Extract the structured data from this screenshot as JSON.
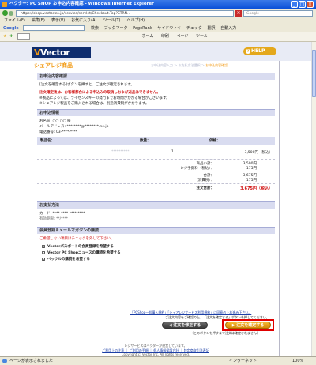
{
  "window": {
    "title": "ベクター: PC SHOP お申込内容確認 - Windows Internet Explorer",
    "minimize": "_",
    "maximize": "□",
    "close": "×"
  },
  "address": {
    "url": "https://shop.vector.co.jp/service/servlet/Checkout.Top?STRN…",
    "search_placeholder": "Google"
  },
  "menu": [
    "ファイル(F)",
    "編集(E)",
    "表示(V)",
    "お気に入り(A)",
    "ツール(T)",
    "ヘルプ(H)"
  ],
  "gbar": {
    "brand": "Google",
    "items": [
      "検索",
      "ブックマーク",
      "PageRank",
      "サイドウィキ",
      "チェック",
      "翻訳",
      "自動入力"
    ]
  },
  "favbar": {
    "items": [
      "ホーム",
      "印刷",
      "ページ",
      "ツール"
    ]
  },
  "header": {
    "logo_main": "Vector",
    "help_label": "HELP"
  },
  "subnav": {
    "brand": "シェアレジ商品",
    "steps": "お申込内容入力 ＞ お支払方法選択 ＞ ",
    "current_step": "お申込内容確認"
  },
  "confirm_section": {
    "title": "お申込内容確認",
    "lines": [
      "[注文を確定する]ボタンを押すと、ご注文が確定されます。",
      "注文確定後は、お客様都合による申込みの取消しおよび返品はできません。",
      "※製品によっては、ライセンスキーの発行までお時間がかかる場合がございます。",
      "※シェアレジ製品をご購入される場合は、別途消費税がかかります。"
    ]
  },
  "customer_section": {
    "title": "お申込情報",
    "lines": [
      "お名前: ○○ ○○ 様",
      "メールアドレス: ********@********.ne.jp",
      "電話番号: 03-****-****"
    ]
  },
  "order_table": {
    "headers": {
      "product": "製品名：",
      "qty": "数量：",
      "price": "価格："
    },
    "row": {
      "name": "**********",
      "qty": "1",
      "price": "3,500円（税込）"
    },
    "summary_labels": [
      "商品小計：",
      "レジ手数料（税込）：",
      "合計：",
      "（消費税）："
    ],
    "summary_values": [
      "3,500円",
      "175円",
      "3,675円",
      "175円"
    ],
    "total_label": "注文合計：",
    "total_value": "3,675円（税込）"
  },
  "payment_section": {
    "title": "お支払方法",
    "lines": [
      "カード: ****-****-****-****",
      "有効期限: **/****"
    ]
  },
  "member_section": {
    "title": "会員登録＆メールマガジンの購読",
    "note": "ご希望しない項目はチェックを外して下さい。",
    "options": [
      "Vectorパスポートの会員登録を希望する",
      "Vector PC Shopニュースの購読を希望する",
      "ベックルの購読を希望する"
    ]
  },
  "terms": {
    "text": "「PCShop一般購入規約」「シェアレジサービス利用規約」に同意の上お進み下さい。",
    "note": "ご注文内容をご確認の上、「注文を確定する」ボタンを押してください。",
    "note2": "（このボタンを押すまで注文は確定されません）"
  },
  "buttons": {
    "back": "注文を修正する",
    "confirm": "注文を確定する"
  },
  "footer": {
    "line1": "レジサービスはベクターが運営しています。",
    "links": "ご利用上の注意 ｜ ご利用の手順 ｜ 個人情報保護方針 ｜ 特定商取引法表記",
    "copyright": "Copyright(c) Vector Inc. All rights reserved."
  },
  "status": {
    "text": "ページが表示されました",
    "zone": "インターネット",
    "zoom": "100%"
  }
}
